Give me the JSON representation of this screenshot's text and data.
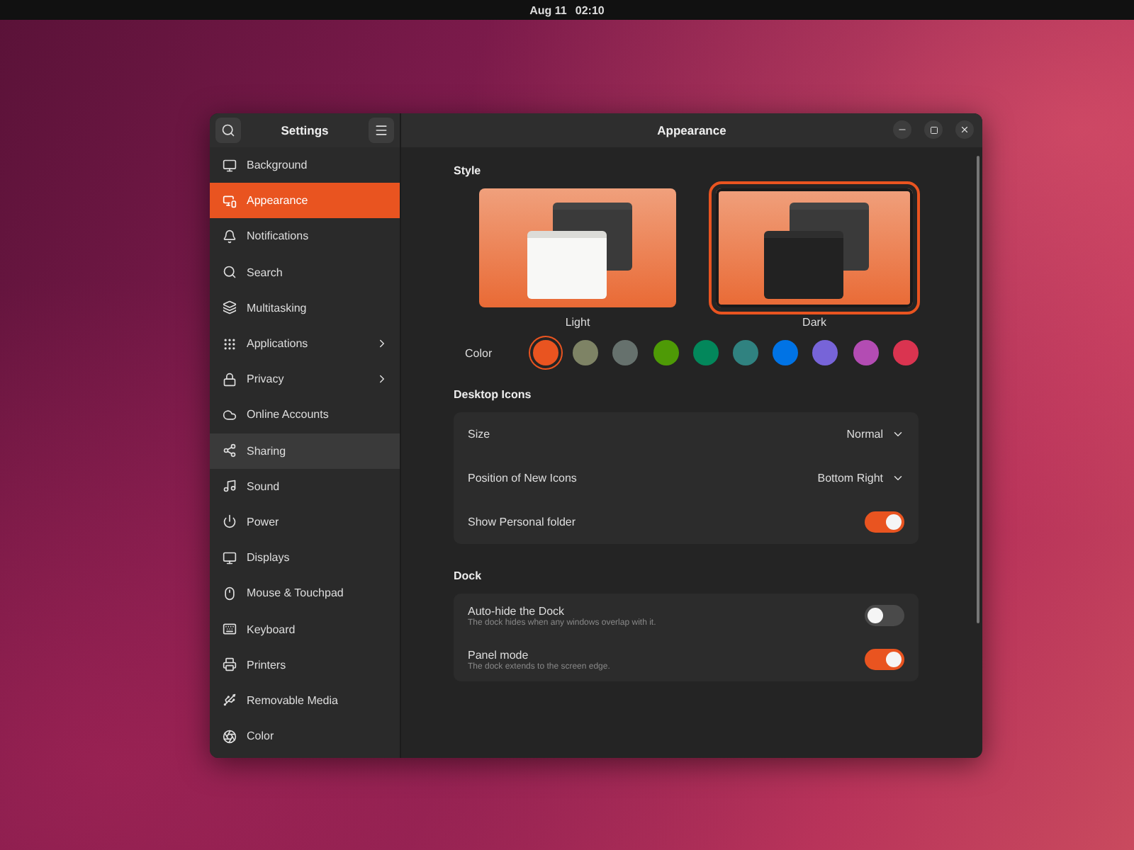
{
  "top_bar": {
    "date": "Aug 11",
    "time": "02:10"
  },
  "sidebar": {
    "title": "Settings",
    "items": [
      {
        "label": "Background",
        "selected": false,
        "hovered": false,
        "has_submenu": false
      },
      {
        "label": "Appearance",
        "selected": true,
        "hovered": false,
        "has_submenu": false
      },
      {
        "label": "Notifications",
        "selected": false,
        "hovered": false,
        "has_submenu": false
      },
      {
        "label": "Search",
        "selected": false,
        "hovered": false,
        "has_submenu": false
      },
      {
        "label": "Multitasking",
        "selected": false,
        "hovered": false,
        "has_submenu": false
      },
      {
        "label": "Applications",
        "selected": false,
        "hovered": false,
        "has_submenu": true
      },
      {
        "label": "Privacy",
        "selected": false,
        "hovered": false,
        "has_submenu": true
      },
      {
        "label": "Online Accounts",
        "selected": false,
        "hovered": false,
        "has_submenu": false
      },
      {
        "label": "Sharing",
        "selected": false,
        "hovered": true,
        "has_submenu": false
      },
      {
        "label": "Sound",
        "selected": false,
        "hovered": false,
        "has_submenu": false
      },
      {
        "label": "Power",
        "selected": false,
        "hovered": false,
        "has_submenu": false
      },
      {
        "label": "Displays",
        "selected": false,
        "hovered": false,
        "has_submenu": false
      },
      {
        "label": "Mouse & Touchpad",
        "selected": false,
        "hovered": false,
        "has_submenu": false
      },
      {
        "label": "Keyboard",
        "selected": false,
        "hovered": false,
        "has_submenu": false
      },
      {
        "label": "Printers",
        "selected": false,
        "hovered": false,
        "has_submenu": false
      },
      {
        "label": "Removable Media",
        "selected": false,
        "hovered": false,
        "has_submenu": false
      },
      {
        "label": "Color",
        "selected": false,
        "hovered": false,
        "has_submenu": false
      }
    ]
  },
  "window": {
    "title": "Appearance"
  },
  "style": {
    "heading": "Style",
    "options": [
      {
        "label": "Light",
        "kind": "light",
        "selected": false
      },
      {
        "label": "Dark",
        "kind": "dark",
        "selected": true
      }
    ],
    "color_label": "Color",
    "colors": [
      {
        "color": "#e95420",
        "selected": true
      },
      {
        "color": "#7e8365",
        "selected": false
      },
      {
        "color": "#66716d",
        "selected": false
      },
      {
        "color": "#4e9a06",
        "selected": false
      },
      {
        "color": "#03875b",
        "selected": false
      },
      {
        "color": "#308280",
        "selected": false
      },
      {
        "color": "#0073e5",
        "selected": false
      },
      {
        "color": "#7764d8",
        "selected": false
      },
      {
        "color": "#b34cb3",
        "selected": false
      },
      {
        "color": "#da3450",
        "selected": false
      }
    ]
  },
  "desktop_icons": {
    "heading": "Desktop Icons",
    "rows": [
      {
        "kind": "dropdown",
        "label": "Size",
        "value": "Normal"
      },
      {
        "kind": "dropdown",
        "label": "Position of New Icons",
        "value": "Bottom Right"
      },
      {
        "kind": "switch",
        "label": "Show Personal folder",
        "on": true
      }
    ]
  },
  "dock": {
    "heading": "Dock",
    "rows": [
      {
        "kind": "switch",
        "label": "Auto-hide the Dock",
        "description": "The dock hides when any windows overlap with it.",
        "on": false
      },
      {
        "kind": "switch",
        "label": "Panel mode",
        "description": "The dock extends to the screen edge.",
        "on": true
      }
    ]
  }
}
